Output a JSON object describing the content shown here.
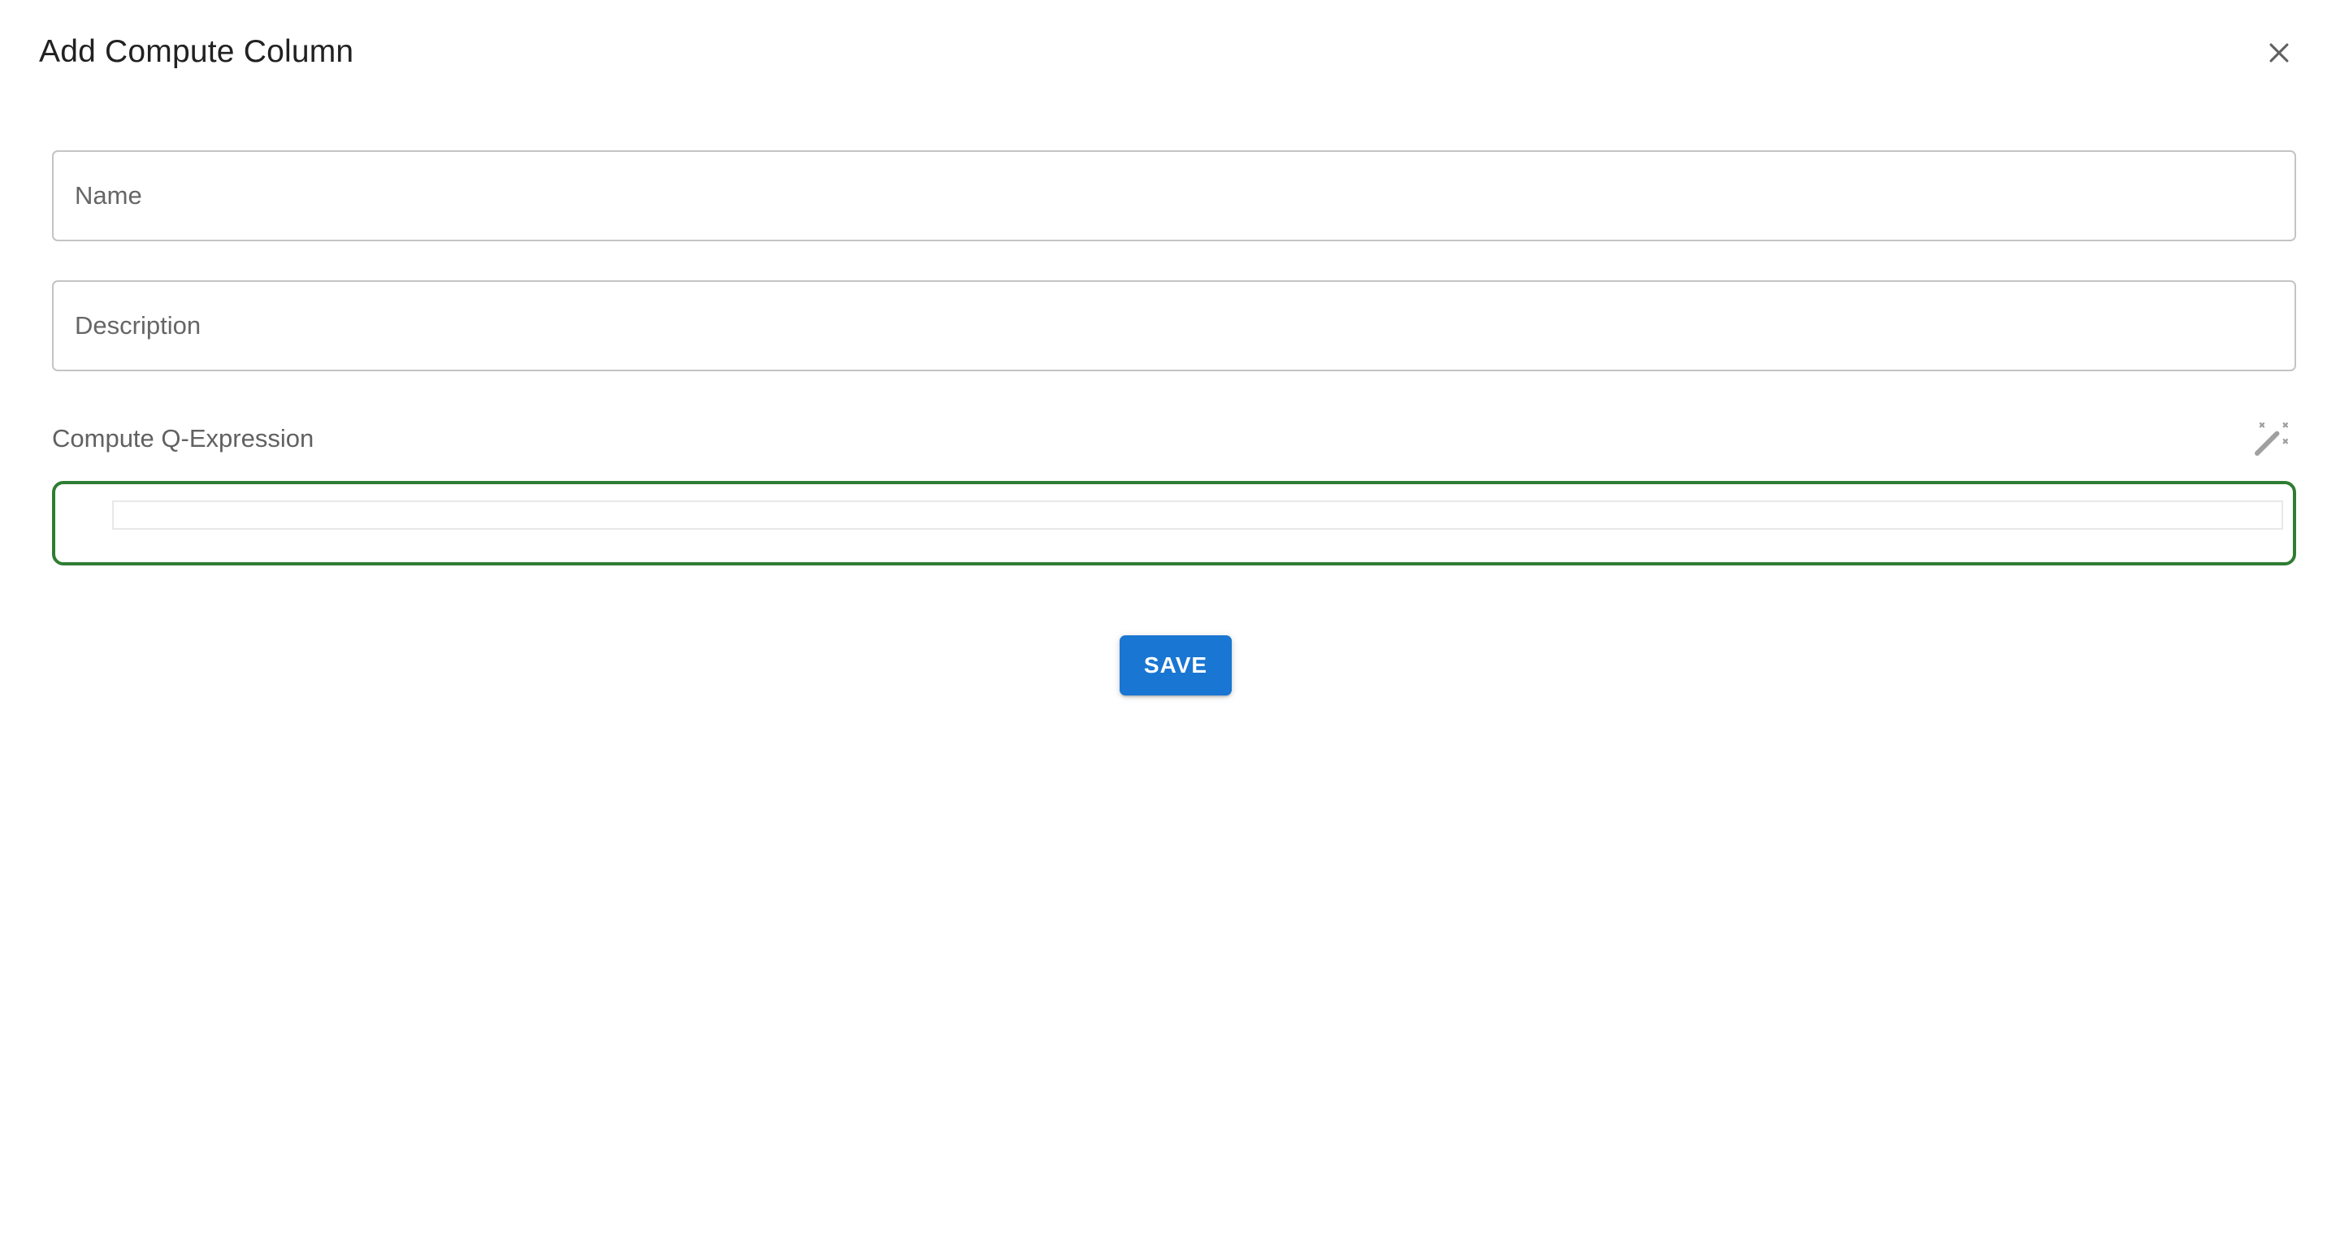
{
  "dialog": {
    "title": "Add Compute Column",
    "close_icon": "close-icon"
  },
  "form": {
    "name": {
      "value": "",
      "placeholder": "Name"
    },
    "description": {
      "value": "",
      "placeholder": "Description"
    },
    "expression": {
      "label": "Compute Q-Expression",
      "value": "",
      "magic_icon": "magic-wand-icon"
    },
    "save_label": "SAVE"
  },
  "colors": {
    "primary": "#1976d2",
    "focus_border": "#2e7d32",
    "input_border": "#c4c4c4",
    "placeholder": "#666666",
    "icon": "#9e9e9e"
  }
}
